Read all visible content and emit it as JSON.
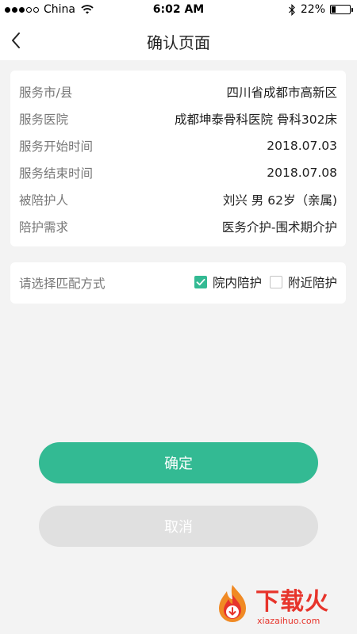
{
  "status_bar": {
    "carrier": "China",
    "time": "6:02 AM",
    "battery_text": "22%",
    "battery_level": 0.22,
    "signal_bars_filled": 3,
    "signal_bars_total": 5
  },
  "nav": {
    "title": "确认页面",
    "back_icon": "chevron-left-icon"
  },
  "info": {
    "rows": [
      {
        "label": "服务市/县",
        "value": "四川省成都市高新区"
      },
      {
        "label": "服务医院",
        "value": "成都坤泰骨科医院  骨科302床"
      },
      {
        "label": "服务开始时间",
        "value": "2018.07.03"
      },
      {
        "label": "服务结束时间",
        "value": "2018.07.08"
      },
      {
        "label": "被陪护人",
        "value": "刘兴  男 62岁（亲属)"
      },
      {
        "label": "陪护需求",
        "value": "医务介护-围术期介护"
      }
    ]
  },
  "match": {
    "label": "请选择匹配方式",
    "options": [
      {
        "label": "院内陪护",
        "checked": true
      },
      {
        "label": "附近陪护",
        "checked": false
      }
    ]
  },
  "actions": {
    "confirm_label": "确定",
    "cancel_label": "取消"
  },
  "watermark": {
    "title": "下载火",
    "url": "xiazaihuo.com"
  },
  "colors": {
    "accent": "#33ba93",
    "cancel_bg": "#e0e0e0",
    "page_bg": "#f3f3f3",
    "watermark": "#e7342b"
  }
}
